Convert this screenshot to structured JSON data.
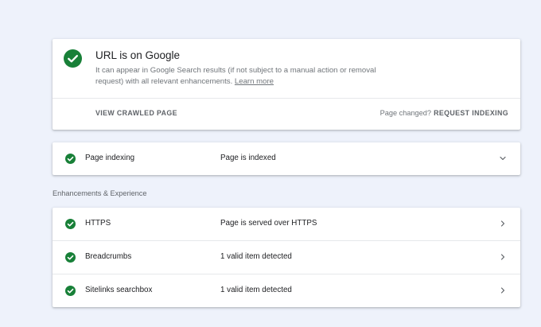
{
  "summary": {
    "title": "URL is on Google",
    "description": "It can appear in Google Search results (if not subject to a manual action or removal request) with all relevant enhancements.",
    "learn_more": "Learn more",
    "view_crawled_label": "VIEW CRAWLED PAGE",
    "page_changed_label": "Page changed?",
    "request_indexing_label": "REQUEST INDEXING"
  },
  "indexing": {
    "label": "Page indexing",
    "status": "Page is indexed"
  },
  "enhancements_title": "Enhancements & Experience",
  "enhancements": [
    {
      "label": "HTTPS",
      "status": "Page is served over HTTPS"
    },
    {
      "label": "Breadcrumbs",
      "status": "1 valid item detected"
    },
    {
      "label": "Sitelinks searchbox",
      "status": "1 valid item detected"
    }
  ],
  "colors": {
    "success_green": "#188038",
    "background": "#eef2fb",
    "card": "#ffffff"
  }
}
